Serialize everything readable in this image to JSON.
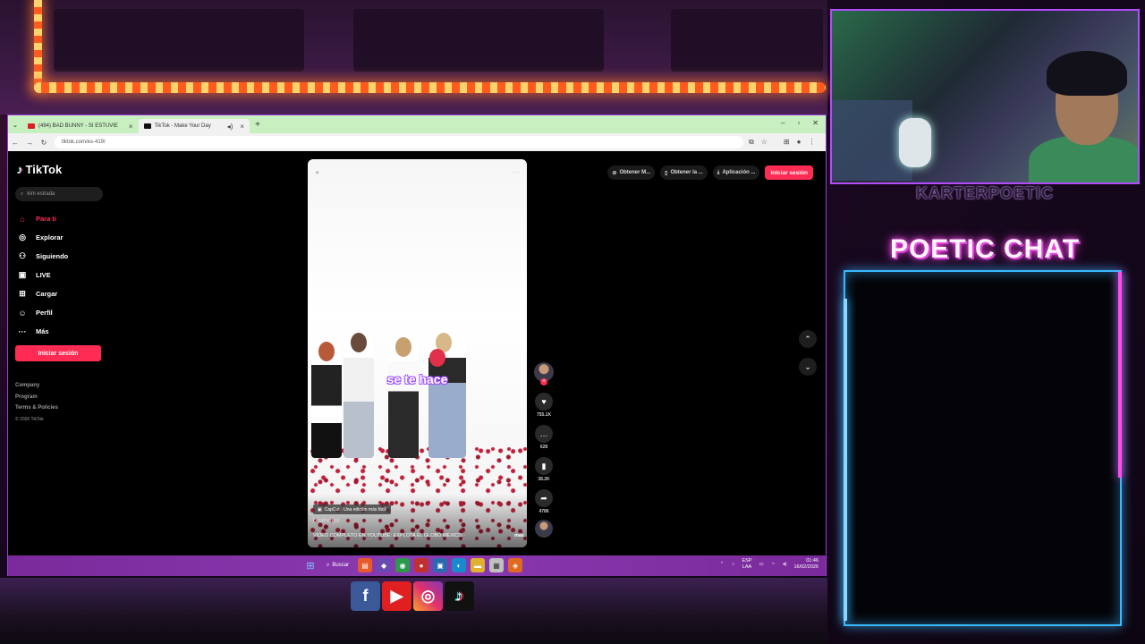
{
  "browser": {
    "tabs": [
      {
        "label": "(494) BAD BUNNY - SI ESTUVIE",
        "favicon_color": "#e02020",
        "active": false
      },
      {
        "label": "TikTok - Make Your Day",
        "favicon_color": "#111111",
        "active": true
      }
    ],
    "url": "tiktok.com/es-419/"
  },
  "tiktok": {
    "logo": "TikTok",
    "search_placeholder": "kim estrada",
    "nav": [
      {
        "label": "Para ti",
        "icon": "home-icon",
        "glyph": "⌂",
        "active": true
      },
      {
        "label": "Explorar",
        "icon": "compass-icon",
        "glyph": "◎",
        "active": false
      },
      {
        "label": "Siguiendo",
        "icon": "following-icon",
        "glyph": "⚇",
        "active": false
      },
      {
        "label": "LIVE",
        "icon": "live-icon",
        "glyph": "▣",
        "active": false
      },
      {
        "label": "Cargar",
        "icon": "upload-icon",
        "glyph": "⊞",
        "active": false
      },
      {
        "label": "Perfil",
        "icon": "profile-icon",
        "glyph": "☺",
        "active": false
      },
      {
        "label": "Más",
        "icon": "more-icon",
        "glyph": "···",
        "active": false
      }
    ],
    "login_label": "Iniciar sesión",
    "footer": {
      "company": "Company",
      "program": "Program",
      "terms": "Terms & Policies",
      "copyright": "© 2026 TikTok"
    },
    "top_buttons": [
      {
        "label": "Obtener M...",
        "glyph": "⊘"
      },
      {
        "label": "Obtener la ...",
        "glyph": "▯"
      },
      {
        "label": "Aplicación ...",
        "glyph": "⤓"
      }
    ],
    "top_login": "Iniciar sesión",
    "video": {
      "caption": "se te hace",
      "capcut_label": "CapCut · Una edición más fácil",
      "username": "briahclips",
      "description": "VIDEO COMPLETO EN YOUTUBE: EXPLOTA EL GLOBO MEXICO ·",
      "more": "más"
    },
    "actions": {
      "likes": "755.1K",
      "comments": "628",
      "saves": "38.2K",
      "shares": "4786"
    }
  },
  "taskbar": {
    "search_label": "Buscar",
    "lang_line1": "ESP",
    "lang_line2": "LAA",
    "time": "01:46",
    "date": "16/02/2026"
  },
  "overlay": {
    "streamer_name": "KARTERPOETIC",
    "chat_title": "POETIC CHAT"
  }
}
